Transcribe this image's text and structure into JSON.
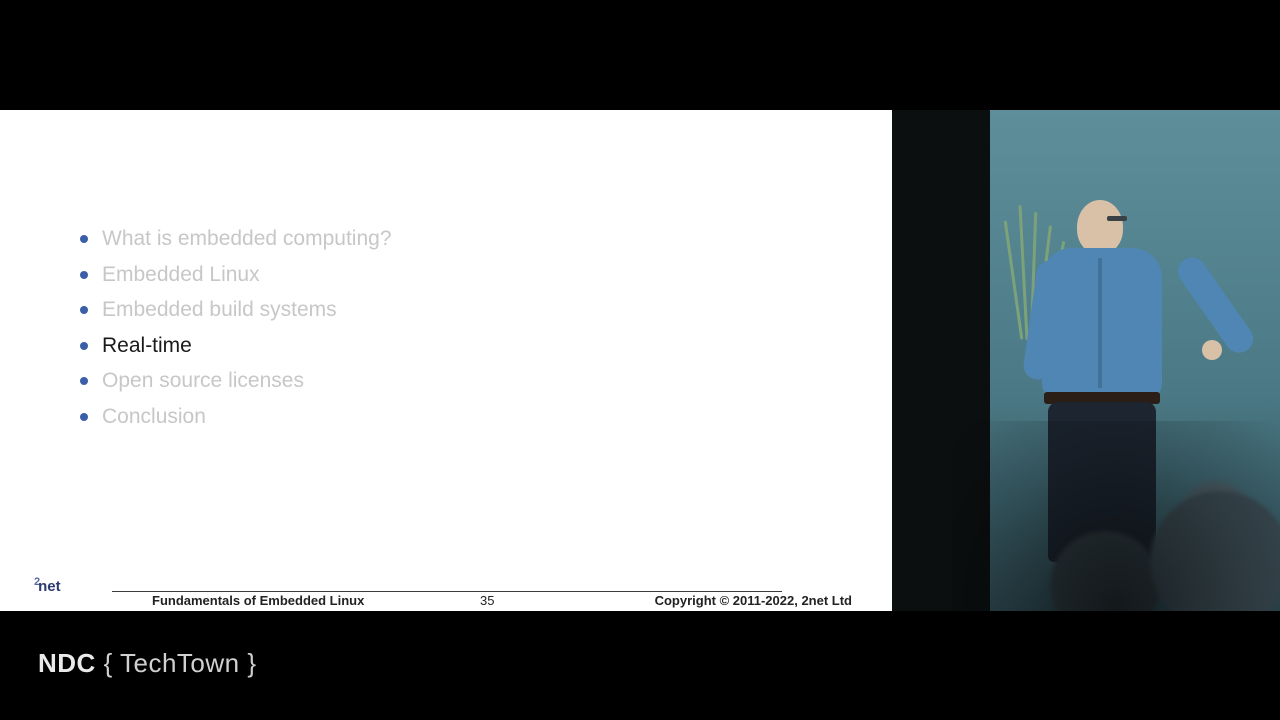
{
  "slide": {
    "bullets": [
      {
        "text": "What is embedded computing?",
        "active": false
      },
      {
        "text": "Embedded Linux",
        "active": false
      },
      {
        "text": "Embedded build systems",
        "active": false
      },
      {
        "text": "Real-time",
        "active": true
      },
      {
        "text": "Open source licenses",
        "active": false
      },
      {
        "text": "Conclusion",
        "active": false
      }
    ],
    "logo_sup": "2",
    "logo_text": "net",
    "footer_title": "Fundamentals of Embedded Linux",
    "page_number": "35",
    "copyright": "Copyright © 2011-2022, 2net Ltd"
  },
  "overlay": {
    "brand_bold": "NDC",
    "brand_rest": " { TechTown }"
  }
}
